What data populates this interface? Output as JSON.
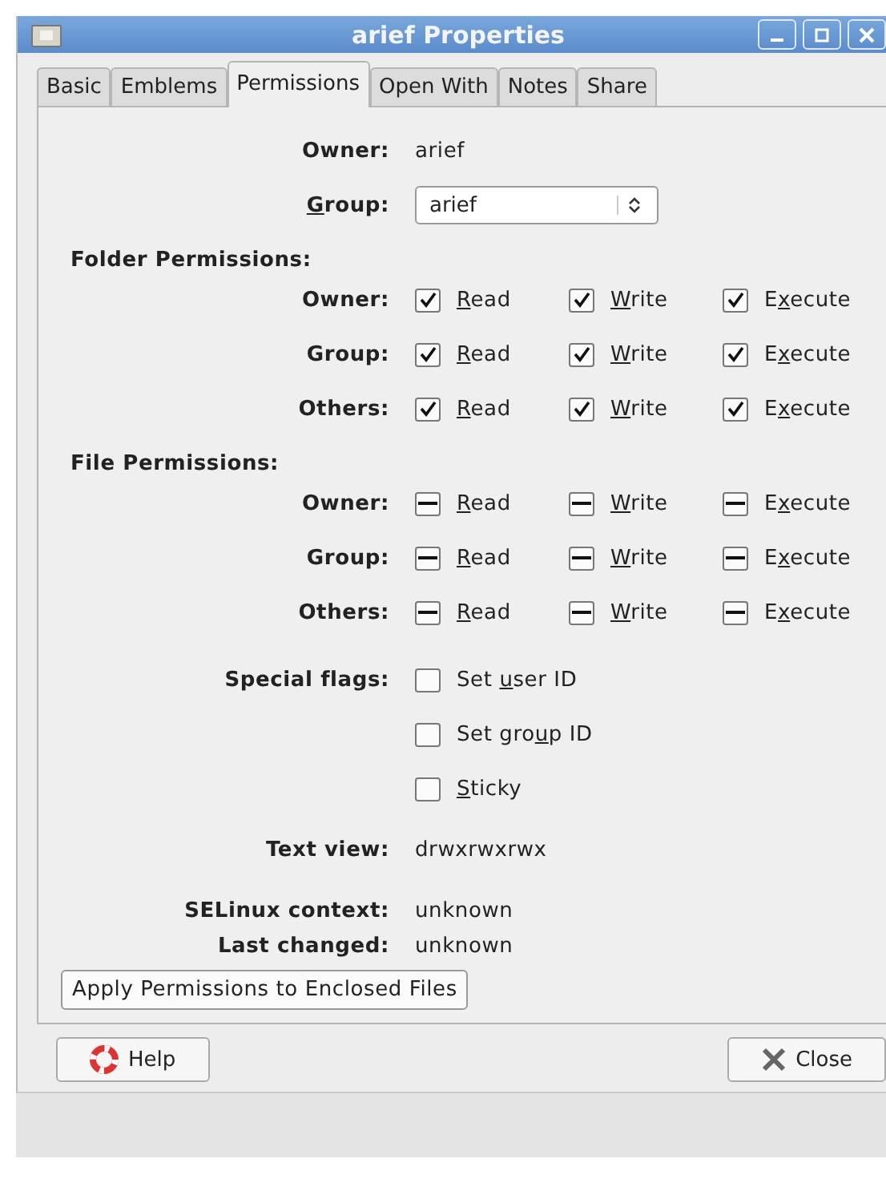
{
  "window": {
    "title": "arief Properties"
  },
  "tabs": [
    {
      "label": "Basic",
      "selected": false
    },
    {
      "label": "Emblems",
      "selected": false
    },
    {
      "label": "Permissions",
      "selected": true
    },
    {
      "label": "Open With",
      "selected": false
    },
    {
      "label": "Notes",
      "selected": false
    },
    {
      "label": "Share",
      "selected": false
    }
  ],
  "owner": {
    "label": "Owner:",
    "value": "arief"
  },
  "group": {
    "label": {
      "key": "G",
      "post": "roup:"
    },
    "value": "arief"
  },
  "sections": [
    {
      "title": "Folder Permissions:",
      "rows": [
        {
          "label": "Owner:",
          "options": [
            {
              "key": "R",
              "post": "ead",
              "checked": true
            },
            {
              "key": "W",
              "post": "rite",
              "checked": true
            },
            {
              "pre": "E",
              "key": "x",
              "post": "ecute",
              "checked": true
            }
          ]
        },
        {
          "label": "Group:",
          "options": [
            {
              "key": "R",
              "post": "ead",
              "checked": true
            },
            {
              "key": "W",
              "post": "rite",
              "checked": true
            },
            {
              "pre": "E",
              "key": "x",
              "post": "ecute",
              "checked": true
            }
          ]
        },
        {
          "label": "Others:",
          "options": [
            {
              "key": "R",
              "post": "ead",
              "checked": true
            },
            {
              "key": "W",
              "post": "rite",
              "checked": true
            },
            {
              "pre": "E",
              "key": "x",
              "post": "ecute",
              "checked": true
            }
          ]
        }
      ]
    },
    {
      "title": "File Permissions:",
      "rows": [
        {
          "label": "Owner:",
          "options": [
            {
              "key": "R",
              "post": "ead",
              "inconsistent": true
            },
            {
              "key": "W",
              "post": "rite",
              "inconsistent": true
            },
            {
              "pre": "E",
              "key": "x",
              "post": "ecute",
              "inconsistent": true
            }
          ]
        },
        {
          "label": "Group:",
          "options": [
            {
              "key": "R",
              "post": "ead",
              "inconsistent": true
            },
            {
              "key": "W",
              "post": "rite",
              "inconsistent": true
            },
            {
              "pre": "E",
              "key": "x",
              "post": "ecute",
              "inconsistent": true
            }
          ]
        },
        {
          "label": "Others:",
          "options": [
            {
              "key": "R",
              "post": "ead",
              "inconsistent": true
            },
            {
              "key": "W",
              "post": "rite",
              "inconsistent": true
            },
            {
              "pre": "E",
              "key": "x",
              "post": "ecute",
              "inconsistent": true
            }
          ]
        }
      ]
    }
  ],
  "special_flags": {
    "label": "Special flags:",
    "flags": [
      {
        "pre": "Set ",
        "key": "u",
        "post": "ser ID",
        "checked": false
      },
      {
        "pre": "Set gro",
        "key": "u",
        "post": "p ID",
        "checked": false
      },
      {
        "key": "S",
        "post": "ticky",
        "checked": false
      }
    ]
  },
  "text_view": {
    "label": "Text view:",
    "value": "drwxrwxrwx"
  },
  "info": [
    {
      "label": "SELinux context:",
      "value": "unknown"
    },
    {
      "label": "Last changed:",
      "value": "unknown"
    }
  ],
  "apply_button": "Apply Permissions to Enclosed Files",
  "buttons": [
    {
      "kind": "help",
      "label": "Help"
    },
    {
      "kind": "close",
      "label": "Close"
    }
  ]
}
